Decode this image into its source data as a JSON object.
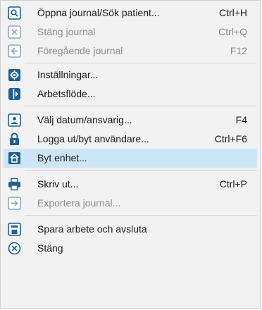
{
  "menu": {
    "items": [
      {
        "label": "Öppna journal/Sök patient...",
        "shortcut": "Ctrl+H",
        "icon": "search-icon",
        "enabled": true
      },
      {
        "label": "Stäng journal",
        "shortcut": "Ctrl+Q",
        "icon": "close-journal-icon",
        "enabled": false
      },
      {
        "label": "Föregående journal",
        "shortcut": "F12",
        "icon": "previous-journal-icon",
        "enabled": false
      },
      {
        "label": "Inställningar...",
        "shortcut": "",
        "icon": "gear-icon",
        "enabled": true
      },
      {
        "label": "Arbetsflöde...",
        "shortcut": "",
        "icon": "workflow-icon",
        "enabled": true
      },
      {
        "label": "Välj datum/ansvarig...",
        "shortcut": "F4",
        "icon": "user-calendar-icon",
        "enabled": true
      },
      {
        "label": "Logga ut/byt användare...",
        "shortcut": "Ctrl+F6",
        "icon": "lock-icon",
        "enabled": true
      },
      {
        "label": "Byt enhet...",
        "shortcut": "",
        "icon": "switch-unit-icon",
        "enabled": true,
        "highlighted": true
      },
      {
        "label": "Skriv ut...",
        "shortcut": "Ctrl+P",
        "icon": "printer-icon",
        "enabled": true
      },
      {
        "label": "Exportera journal...",
        "shortcut": "",
        "icon": "export-icon",
        "enabled": false
      },
      {
        "label": "Spara arbete och avsluta",
        "shortcut": "",
        "icon": "save-exit-icon",
        "enabled": true
      },
      {
        "label": "Stäng",
        "shortcut": "",
        "icon": "close-icon",
        "enabled": true
      }
    ]
  },
  "colors": {
    "menu_background": "#f2f2f2",
    "highlight": "#cce6f7",
    "icon_blue": "#1b5f95",
    "icon_disabled": "#8fa9bf",
    "disabled_text": "#8c8c8c"
  }
}
